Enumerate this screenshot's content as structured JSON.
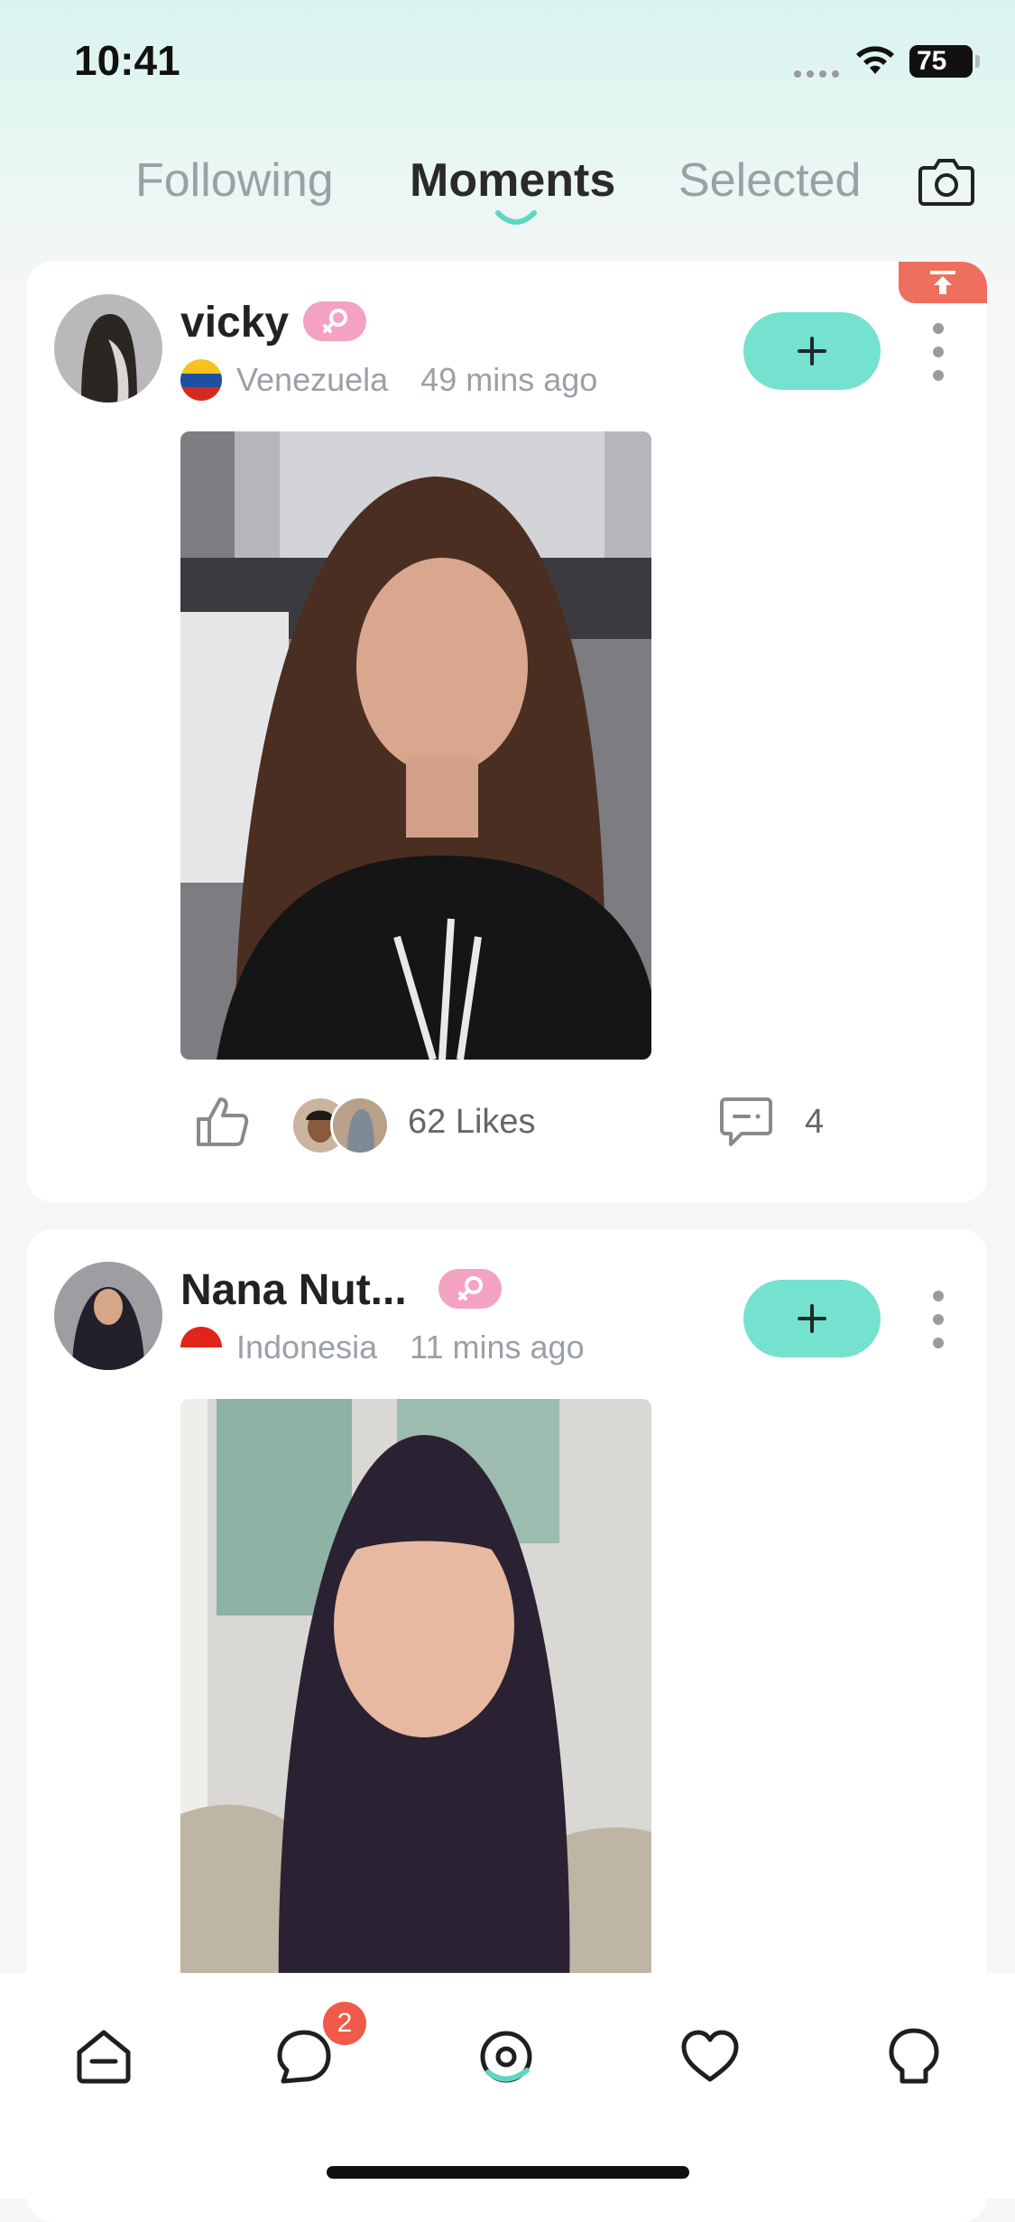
{
  "status_bar": {
    "time": "10:41",
    "battery": "75"
  },
  "tabs": [
    {
      "label": "Following",
      "active": false
    },
    {
      "label": "Moments",
      "active": true
    },
    {
      "label": "Selected",
      "active": false
    }
  ],
  "posts": [
    {
      "username": "vicky",
      "country": "Venezuela",
      "time_ago": "49 mins ago",
      "pinned": true,
      "likes_text": "62 Likes",
      "comments": "4"
    },
    {
      "username": "Nana Nut...",
      "country": "Indonesia",
      "time_ago": "11 mins ago",
      "pinned": false
    }
  ],
  "bottom_nav": {
    "items": [
      "home-icon",
      "chat-icon",
      "moments-icon",
      "heart-icon",
      "profile-icon"
    ],
    "chat_badge": "2"
  },
  "colors": {
    "accent": "#74e2cf",
    "pin": "#ef6f5f",
    "badge": "#ef5a4a",
    "gender": "#f4a2c2"
  }
}
